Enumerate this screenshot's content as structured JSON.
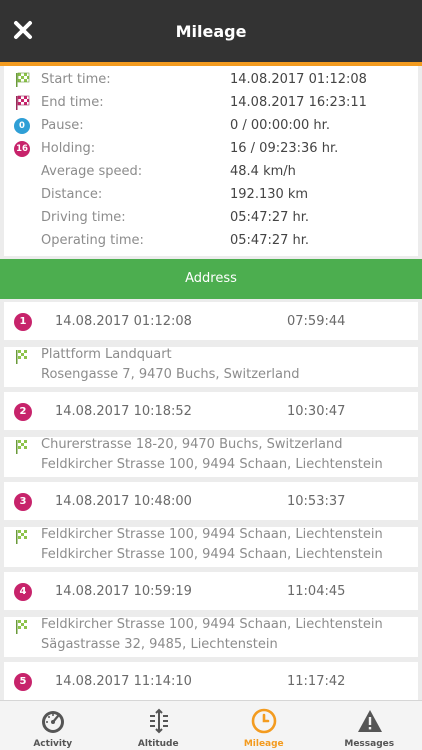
{
  "header": {
    "title": "Mileage",
    "close_icon": "close-icon"
  },
  "summary": [
    {
      "label": "Start time:",
      "value": "14.08.2017 01:12:08",
      "icon": "flag-green-icon"
    },
    {
      "label": "End time:",
      "value": "14.08.2017 16:23:11",
      "icon": "flag-red-icon"
    },
    {
      "label": "Pause:",
      "value": "0 / 00:00:00 hr.",
      "icon": "pause-count-badge",
      "badge": "0"
    },
    {
      "label": "Holding:",
      "value": "16 / 09:23:36 hr.",
      "icon": "holding-count-badge",
      "badge": "16"
    },
    {
      "label": "Average speed:",
      "value": "48.4 km/h"
    },
    {
      "label": "Distance:",
      "value": "192.130 km"
    },
    {
      "label": "Driving time:",
      "value": "05:47:27 hr."
    },
    {
      "label": "Operating time:",
      "value": "05:47:27 hr."
    }
  ],
  "address_section": {
    "label": "Address"
  },
  "stops": [
    {
      "num": "1",
      "start": "14.08.2017 01:12:08",
      "end": "07:59:44"
    },
    {
      "num": "2",
      "start": "14.08.2017 10:18:52",
      "end": "10:30:47"
    },
    {
      "num": "3",
      "start": "14.08.2017 10:48:00",
      "end": "10:53:37"
    },
    {
      "num": "4",
      "start": "14.08.2017 10:59:19",
      "end": "11:04:45"
    },
    {
      "num": "5",
      "start": "14.08.2017 11:14:10",
      "end": "11:17:42"
    }
  ],
  "routes": [
    {
      "from": "Plattform Landquart",
      "to": "Rosengasse 7, 9470 Buchs, Switzerland"
    },
    {
      "from": "Churerstrasse 18-20, 9470 Buchs, Switzerland",
      "to": "Feldkircher Strasse 100, 9494 Schaan, Liechtenstein"
    },
    {
      "from": "Feldkircher Strasse 100, 9494 Schaan, Liechtenstein",
      "to": "Feldkircher Strasse 100, 9494 Schaan, Liechtenstein"
    },
    {
      "from": "Feldkircher Strasse 100, 9494 Schaan, Liechtenstein",
      "to": "Sägastrasse 32, 9485, Liechtenstein"
    }
  ],
  "tabs": [
    {
      "label": "Activity",
      "icon": "speedometer-icon",
      "active": false
    },
    {
      "label": "Altitude",
      "icon": "altitude-icon",
      "active": false
    },
    {
      "label": "Mileage",
      "icon": "clock-icon",
      "active": true
    },
    {
      "label": "Messages",
      "icon": "warning-icon",
      "active": false
    }
  ],
  "colors": {
    "header": "#333333",
    "accent": "#f39b1f",
    "address_bar": "#4cae4f",
    "stop_badge": "#c7236b",
    "pause_badge": "#2f9fd6"
  }
}
